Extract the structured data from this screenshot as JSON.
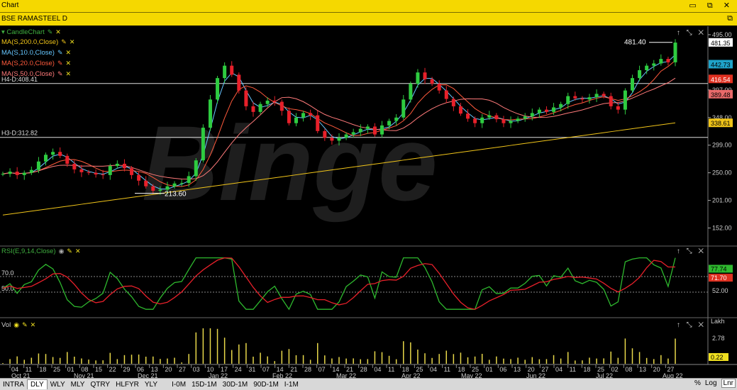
{
  "window": {
    "title": "Chart",
    "controls": "▭ ⧉ ✕"
  },
  "chart_header": {
    "symbol": "BSE RAMASTEEL D",
    "restore_icon": "⧉"
  },
  "indicators": [
    {
      "label": "CandleChart",
      "color": "#3fae3f"
    },
    {
      "label": "MA(S,200.0,Close)",
      "color": "#f0c419"
    },
    {
      "label": "MA(S,10.0,Close)",
      "color": "#66c7ff"
    },
    {
      "label": "MA(S,20.0,Close)",
      "color": "#ff5a3c"
    },
    {
      "label": "MA(S,50.0,Close)",
      "color": "#ff7a7a"
    }
  ],
  "h_lines": [
    {
      "label": "H4-D:408.41",
      "value": 408.41
    },
    {
      "label": "H3-D:312.82",
      "value": 312.82
    }
  ],
  "annotations": {
    "high_label": "481.40",
    "low_label": "213.60"
  },
  "watermark": "Binge",
  "price_axis": {
    "ticks": [
      "495.00",
      "397.00",
      "348.00",
      "299.00",
      "250.00",
      "201.00",
      "152.00"
    ],
    "badges": [
      {
        "text": "481.35",
        "bg": "#ffffff",
        "fg": "#000000"
      },
      {
        "text": "442.73",
        "bg": "#1fa3c9",
        "fg": "#000000"
      },
      {
        "text": "416.54",
        "bg": "#e03020",
        "fg": "#ffffff"
      },
      {
        "text": "389.48",
        "bg": "#e86a6a",
        "fg": "#000000"
      },
      {
        "text": "338.61",
        "bg": "#f0c419",
        "fg": "#000000"
      }
    ]
  },
  "rsi_panel": {
    "label": "RSI(E,9,14,Close)",
    "levels": [
      "70.0",
      "50.0"
    ],
    "axis_tick": "52.00",
    "badges": [
      {
        "text": "77.74",
        "bg": "#2eb82e",
        "fg": "#000000"
      },
      {
        "text": "71.70",
        "bg": "#e03020",
        "fg": "#ffffff"
      }
    ]
  },
  "vol_panel": {
    "label": "Vol",
    "axis_unit": "Lakh",
    "axis_tick": "2.78",
    "badge": {
      "text": "0.22",
      "bg": "#f0e020",
      "fg": "#000000"
    }
  },
  "date_axis": {
    "labels": [
      "04",
      "11",
      "18",
      "25",
      "01",
      "08",
      "15",
      "22",
      "29",
      "06",
      "13",
      "20",
      "27",
      "03",
      "10",
      "17",
      "24",
      "31",
      "07",
      "14",
      "21",
      "28",
      "07",
      "14",
      "21",
      "28",
      "04",
      "11",
      "18",
      "25",
      "04",
      "11",
      "18",
      "25",
      "01",
      "06",
      "13",
      "20",
      "27",
      "04",
      "11",
      "18",
      "25",
      "02",
      "08",
      "13",
      "20",
      "27"
    ],
    "months": [
      "Oct 21",
      "Nov 21",
      "Dec 21",
      "Jan 22",
      "Feb 22",
      "Mar 22",
      "Apr 22",
      "May 22",
      "Jun 22",
      "Jul 22",
      "Aug 22"
    ]
  },
  "bottom_bar": {
    "periods": [
      "INTRA",
      "DLY",
      "WLY",
      "MLY",
      "QTRY",
      "HLFYR",
      "YLY"
    ],
    "selected": "DLY",
    "intervals": [
      "I-0M",
      "15D-1M",
      "30D-1M",
      "90D-1M",
      "I-1M"
    ],
    "right": [
      "%",
      "Log",
      "Lnr"
    ]
  },
  "panel_controls": "↑ ⤡ ✕",
  "chart_data": {
    "type": "candlestick",
    "price_range": [
      120,
      510
    ],
    "closes": [
      248,
      252,
      246,
      250,
      255,
      270,
      282,
      287,
      280,
      266,
      256,
      251,
      250,
      247,
      246,
      262,
      266,
      258,
      246,
      236,
      226,
      218,
      220,
      226,
      231,
      232,
      244,
      272,
      330,
      380,
      418,
      440,
      424,
      396,
      368,
      358,
      372,
      378,
      376,
      360,
      338,
      348,
      356,
      352,
      324,
      312,
      307,
      312,
      318,
      322,
      328,
      332,
      318,
      334,
      342,
      348,
      380,
      408,
      428,
      416,
      408,
      396,
      381,
      368,
      355,
      346,
      338,
      348,
      352,
      345,
      338,
      342,
      346,
      350,
      356,
      362,
      358,
      366,
      372,
      386,
      382,
      380,
      384,
      390,
      386,
      368,
      362,
      396,
      418,
      432,
      440,
      444,
      452,
      446,
      481
    ]
  }
}
